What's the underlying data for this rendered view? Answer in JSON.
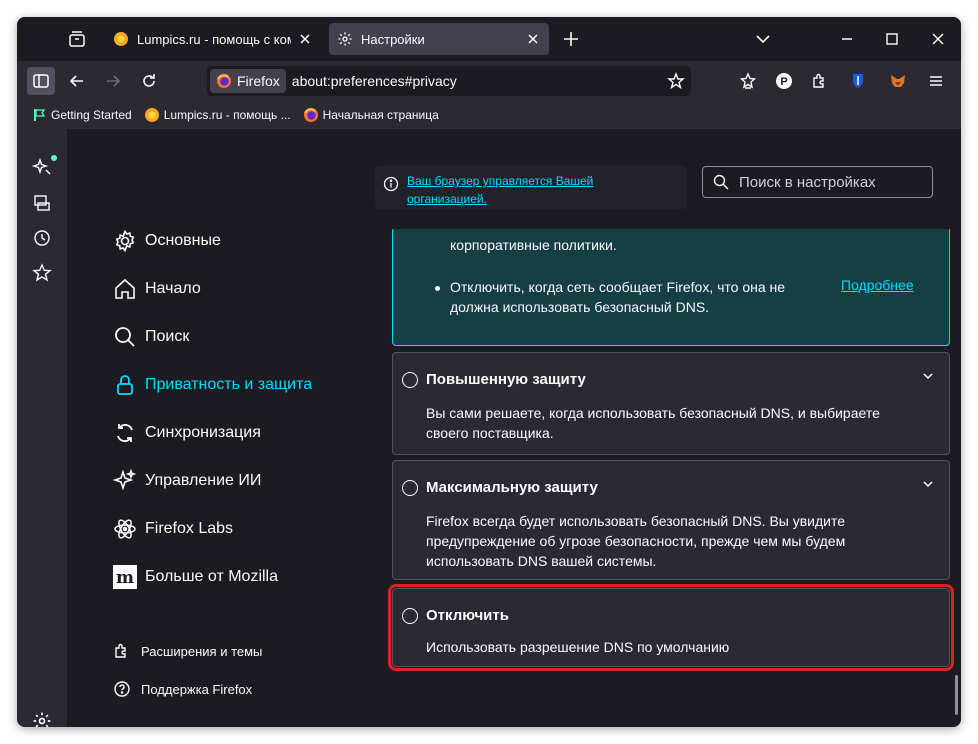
{
  "tabs": [
    {
      "label": "Lumpics.ru - помощь с компьютером",
      "active": false
    },
    {
      "label": "Настройки",
      "active": true
    }
  ],
  "navbar": {
    "identity_label": "Firefox",
    "url": "about:preferences#privacy"
  },
  "bookmarks": [
    {
      "label": "Getting Started"
    },
    {
      "label": "Lumpics.ru - помощь ..."
    },
    {
      "label": "Начальная страница"
    }
  ],
  "categories": [
    {
      "label": "Основные",
      "icon": "gear-icon"
    },
    {
      "label": "Начало",
      "icon": "home-icon"
    },
    {
      "label": "Поиск",
      "icon": "search-icon"
    },
    {
      "label": "Приватность и защита",
      "icon": "lock-icon",
      "selected": true
    },
    {
      "label": "Синхронизация",
      "icon": "sync-icon"
    },
    {
      "label": "Управление ИИ",
      "icon": "sparkle-icon"
    },
    {
      "label": "Firefox Labs",
      "icon": "atom-icon"
    },
    {
      "label": "Больше от Mozilla",
      "icon": "mozilla-icon"
    }
  ],
  "footer_links": [
    {
      "label": "Расширения и темы",
      "icon": "puzzle-icon"
    },
    {
      "label": "Поддержка Firefox",
      "icon": "help-icon"
    }
  ],
  "policy_notice": {
    "line1": "Ваш браузер управляется Вашей",
    "line2": "организацией."
  },
  "search": {
    "placeholder": "Поиск в настройках"
  },
  "default_panel": {
    "top_text": "корпоративные политики.",
    "bullet_line1": "Отключить, когда сеть сообщает Firefox, что она не",
    "bullet_line2": "должна использовать безопасный DNS.",
    "learn_more": "Подробнее"
  },
  "options": [
    {
      "title": "Повышенную защиту",
      "desc": "Вы сами решаете, когда использовать безопасный DNS, и выбираете своего поставщика."
    },
    {
      "title": "Максимальную защиту",
      "desc": "Firefox всегда будет использовать безопасный DNS. Вы увидите предупреждение об угрозе безопасности, прежде чем мы будем использовать DNS вашей системы."
    },
    {
      "title": "Отключить",
      "desc": "Использовать разрешение DNS по умолчанию"
    }
  ],
  "colors": {
    "accent": "#00ddff",
    "highlight": "#e02020",
    "background": "#1c1b22",
    "panel": "#2b2a33"
  }
}
